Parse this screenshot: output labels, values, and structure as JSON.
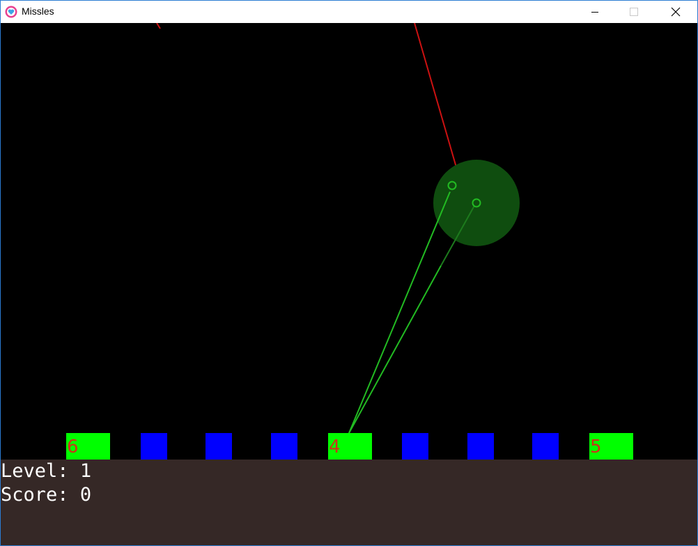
{
  "window": {
    "title": "Missles",
    "accent": "#2b7cd3",
    "icons": {
      "app": "heart-app-icon",
      "minimize": "minimize-icon",
      "maximize": "maximize-icon",
      "close": "close-icon"
    }
  },
  "hud": {
    "level_label": "Level:",
    "level_value": "1",
    "score_label": "Score:",
    "score_value": "0",
    "background": "#352826"
  },
  "colors": {
    "city": "#00ff00",
    "battery": "#0000ff",
    "enemy_missile": "#cc1111",
    "defense_missile": "#22bb22",
    "explosion": "#0f4d0f",
    "city_label": "#d0311a"
  },
  "ground_units": [
    {
      "kind": "city",
      "label": "6"
    },
    {
      "kind": "battery",
      "label": ""
    },
    {
      "kind": "battery",
      "label": ""
    },
    {
      "kind": "battery",
      "label": ""
    },
    {
      "kind": "city",
      "label": "4"
    },
    {
      "kind": "battery",
      "label": ""
    },
    {
      "kind": "battery",
      "label": ""
    },
    {
      "kind": "battery",
      "label": ""
    },
    {
      "kind": "city",
      "label": "5"
    }
  ]
}
